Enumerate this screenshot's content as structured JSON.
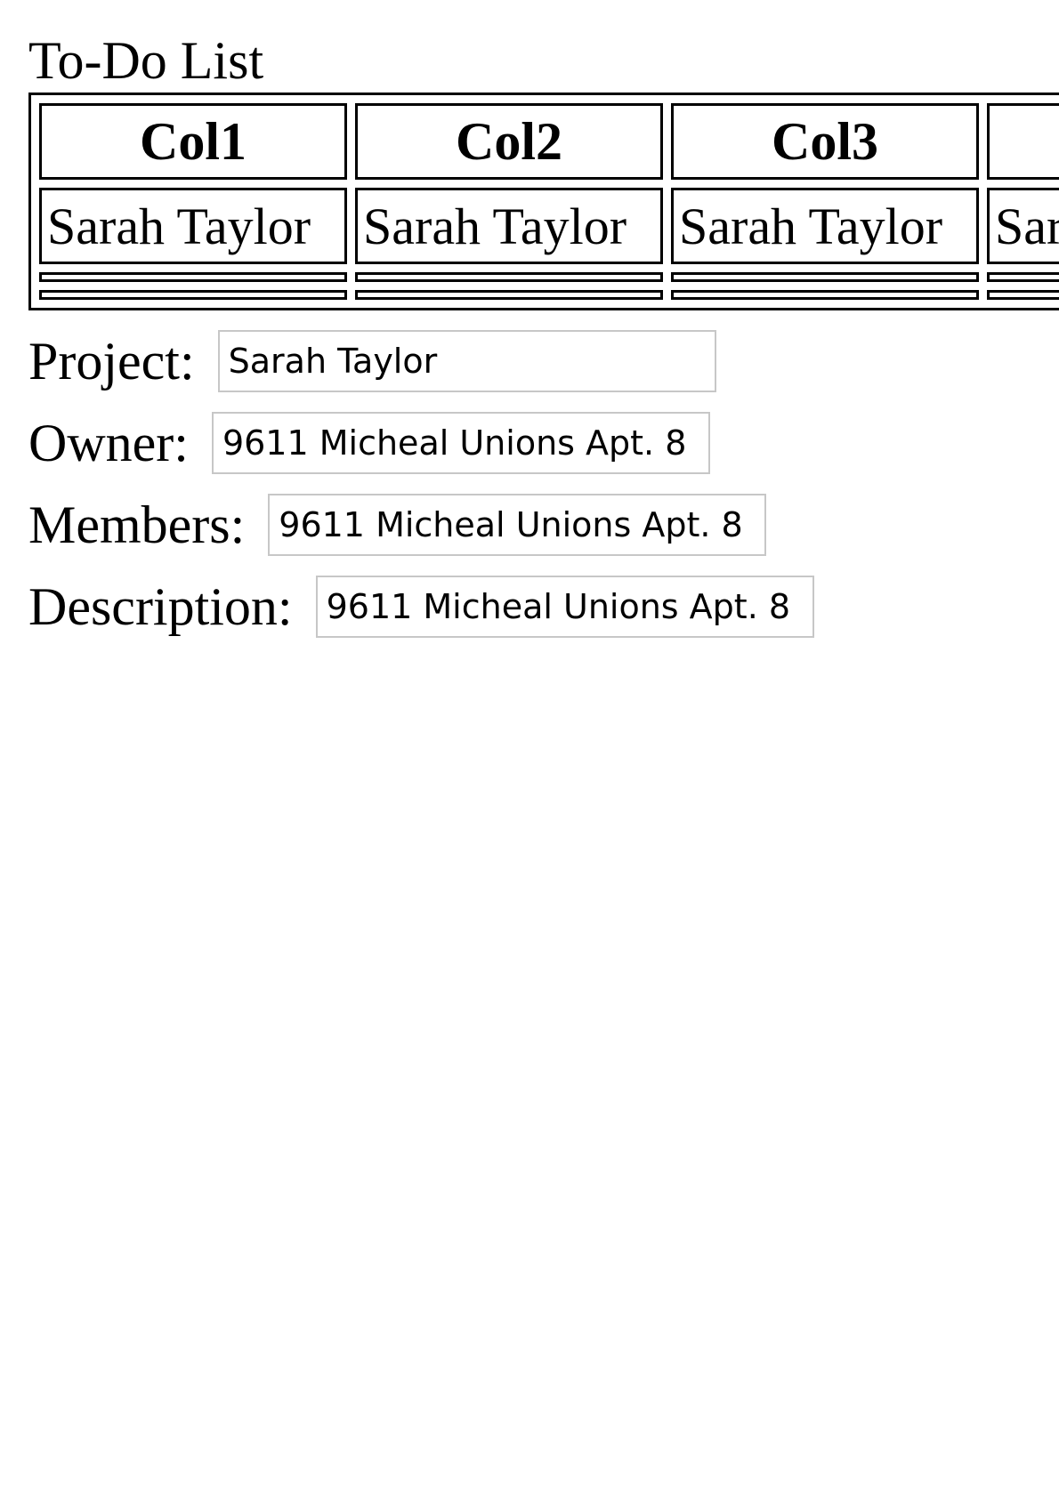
{
  "title": "To-Do List",
  "table": {
    "headers": [
      "Col1",
      "Col2",
      "Col3",
      ""
    ],
    "rows": [
      [
        "Sarah Taylor",
        "Sarah Taylor",
        "Sarah Taylor",
        "Sarah Taylor"
      ],
      [
        "",
        "",
        "",
        ""
      ],
      [
        "",
        "",
        "",
        ""
      ]
    ]
  },
  "form": {
    "project": {
      "label": "Project:",
      "value": "Sarah Taylor"
    },
    "owner": {
      "label": "Owner:",
      "value": "9611 Micheal Unions Apt. 8"
    },
    "members": {
      "label": "Members:",
      "value": "9611 Micheal Unions Apt. 8"
    },
    "description": {
      "label": "Description:",
      "value": "9611 Micheal Unions Apt. 8"
    }
  }
}
